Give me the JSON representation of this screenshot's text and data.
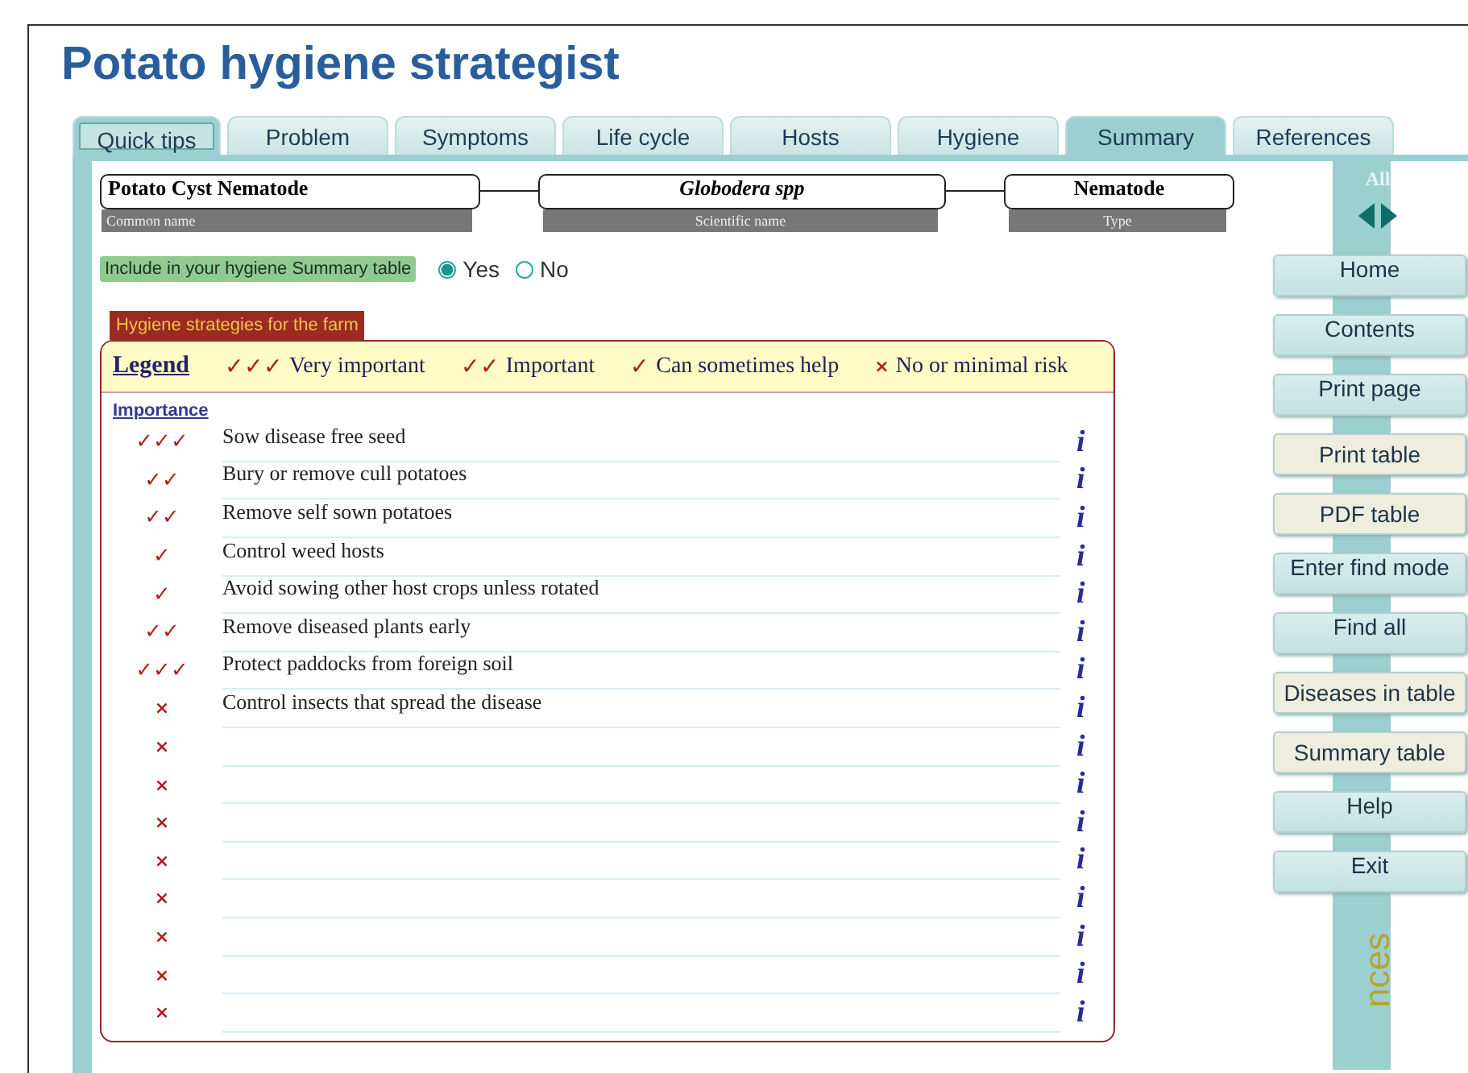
{
  "title": "Potato hygiene strategist",
  "tabs": [
    {
      "label": "Quick tips",
      "selected": true,
      "highlighted": false
    },
    {
      "label": "Problem",
      "selected": false,
      "highlighted": false
    },
    {
      "label": "Symptoms",
      "selected": false,
      "highlighted": false
    },
    {
      "label": "Life cycle",
      "selected": false,
      "highlighted": false
    },
    {
      "label": "Hosts",
      "selected": false,
      "highlighted": false
    },
    {
      "label": "Hygiene",
      "selected": false,
      "highlighted": false
    },
    {
      "label": "Summary",
      "selected": false,
      "highlighted": true
    },
    {
      "label": "References",
      "selected": false,
      "highlighted": false
    }
  ],
  "identity": [
    {
      "value": "Potato Cyst Nematode",
      "caption": "Common name",
      "kind": "common"
    },
    {
      "value": "Globodera spp",
      "caption": "Scientific name",
      "kind": "scientific"
    },
    {
      "value": "Nematode",
      "caption": "Type",
      "kind": "type"
    }
  ],
  "include": {
    "label": "Include in your hygiene Summary table",
    "options": [
      {
        "label": "Yes",
        "selected": true
      },
      {
        "label": "No",
        "selected": false
      }
    ]
  },
  "strategies": {
    "heading": "Hygiene strategies for the farm",
    "legend_link": "Legend",
    "legend": [
      {
        "mark": "✓✓✓",
        "label": "Very important",
        "kind": "tick"
      },
      {
        "mark": "✓✓",
        "label": "Important",
        "kind": "tick"
      },
      {
        "mark": "✓",
        "label": "Can sometimes help",
        "kind": "tick"
      },
      {
        "mark": "×",
        "label": "No or minimal risk",
        "kind": "cross"
      }
    ],
    "column_link": "Importance",
    "rows": [
      {
        "mark": "✓✓✓",
        "kind": "tick",
        "text": "Sow disease free seed",
        "info": "i"
      },
      {
        "mark": "✓✓",
        "kind": "tick",
        "text": "Bury or remove cull potatoes",
        "info": "i"
      },
      {
        "mark": "✓✓",
        "kind": "tick",
        "text": "Remove self sown potatoes",
        "info": "i"
      },
      {
        "mark": "✓",
        "kind": "tick",
        "text": "Control weed hosts",
        "info": "i"
      },
      {
        "mark": "✓",
        "kind": "tick",
        "text": "Avoid sowing other host crops unless rotated",
        "info": "i"
      },
      {
        "mark": "✓✓",
        "kind": "tick",
        "text": "Remove diseased plants early",
        "info": "i"
      },
      {
        "mark": "✓✓✓",
        "kind": "tick",
        "text": "Protect paddocks from foreign soil",
        "info": "i"
      },
      {
        "mark": "×",
        "kind": "cross",
        "text": "Control insects that spread the disease",
        "info": "i"
      },
      {
        "mark": "×",
        "kind": "cross",
        "info": "i"
      },
      {
        "mark": "×",
        "kind": "cross",
        "info": "i"
      },
      {
        "mark": "×",
        "kind": "cross",
        "info": "i"
      },
      {
        "mark": "×",
        "kind": "cross",
        "info": "i"
      },
      {
        "mark": "×",
        "kind": "cross",
        "info": "i"
      },
      {
        "mark": "×",
        "kind": "cross",
        "info": "i"
      },
      {
        "mark": "×",
        "kind": "cross",
        "info": "i"
      },
      {
        "mark": "×",
        "kind": "cross",
        "info": "i"
      }
    ]
  },
  "nav": {
    "all_label": "All",
    "buttons": [
      {
        "label": "Home",
        "kind": "nav"
      },
      {
        "label": "Contents",
        "kind": "nav"
      },
      {
        "label": "Print page",
        "kind": "nav"
      },
      {
        "label": "Print table",
        "kind": "table"
      },
      {
        "label": "PDF table",
        "kind": "table"
      },
      {
        "label": "Enter find mode",
        "kind": "nav"
      },
      {
        "label": "Find all",
        "kind": "nav"
      },
      {
        "label": "Diseases in table",
        "kind": "table"
      },
      {
        "label": "Summary table",
        "kind": "table"
      },
      {
        "label": "Help",
        "kind": "nav"
      },
      {
        "label": "Exit",
        "kind": "nav"
      }
    ],
    "vertical_label": "nces"
  }
}
